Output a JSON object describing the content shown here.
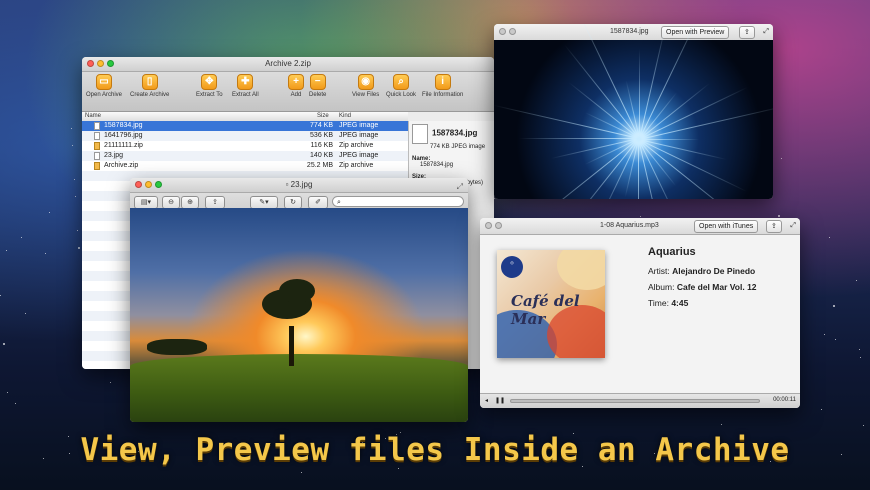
{
  "archive": {
    "title": "Archive 2.zip",
    "toolbar": [
      {
        "label": "Open Archive",
        "icon": "open-archive-icon"
      },
      {
        "label": "Create Archive",
        "icon": "create-archive-icon"
      },
      {
        "label": "Extract To",
        "icon": "extract-to-icon"
      },
      {
        "label": "Extract All",
        "icon": "extract-all-icon"
      },
      {
        "label": "Add",
        "icon": "add-icon"
      },
      {
        "label": "Delete",
        "icon": "delete-icon"
      },
      {
        "label": "View Files",
        "icon": "view-files-icon"
      },
      {
        "label": "Quick Look",
        "icon": "quick-look-icon"
      },
      {
        "label": "File Information",
        "icon": "info-icon"
      }
    ],
    "columns": {
      "name": "Name",
      "size": "Size",
      "kind": "Kind"
    },
    "files": [
      {
        "name": "1587834.jpg",
        "size": "774 KB",
        "kind": "JPEG image"
      },
      {
        "name": "1641796.jpg",
        "size": "536 KB",
        "kind": "JPEG image"
      },
      {
        "name": "21111111.zip",
        "size": "116 KB",
        "kind": "Zip archive"
      },
      {
        "name": "23.jpg",
        "size": "140 KB",
        "kind": "JPEG image"
      },
      {
        "name": "Archive.zip",
        "size": "25.2 MB",
        "kind": "Zip archive"
      }
    ],
    "info": {
      "file_name": "1587834.jpg",
      "file_sub": "774 KB JPEG image",
      "name_label": "Name:",
      "name_value": "1587834.jpg",
      "size_label": "Size:",
      "size_value": "774 KB (775,884 bytes)"
    }
  },
  "preview_image": {
    "title": "1587834.jpg",
    "open_button": "Open with Preview"
  },
  "preview_23": {
    "title": "23.jpg"
  },
  "audio": {
    "title": "1-08 Aquarius.mp3",
    "open_button": "Open with iTunes",
    "track_title": "Aquarius",
    "artist_label": "Artist:",
    "artist": "Alejandro De Pinedo",
    "album_label": "Album:",
    "album": "Cafe del Mar Vol. 12",
    "time_label": "Time:",
    "time": "4:45",
    "elapsed": "00:00:11",
    "cover_text": "Café del Mar"
  },
  "caption": "View, Preview files Inside an Archive",
  "colors": {
    "accent_orange": "#f29a1a",
    "selection_blue": "#3875d7",
    "caption_gold": "#f4c74a"
  }
}
